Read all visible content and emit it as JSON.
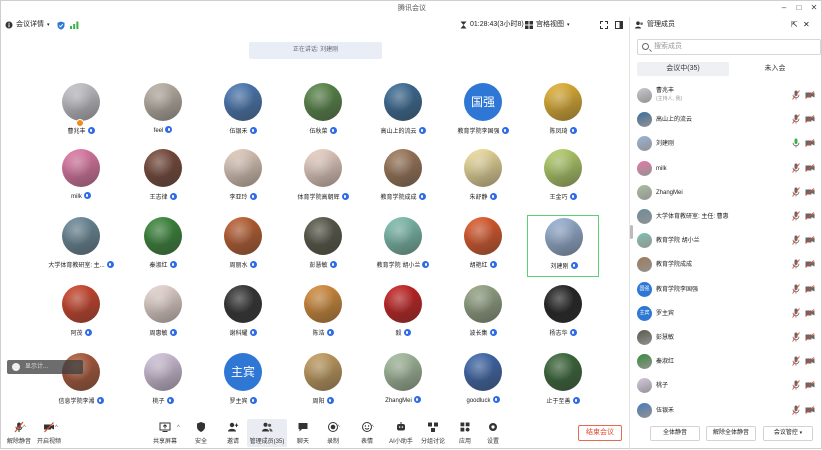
{
  "window": {
    "title": "腾讯会议"
  },
  "topbar": {
    "meeting_info_label": "会议详情",
    "timer": "01:28:43(3小时8)",
    "view_mode": "宫格视图"
  },
  "speaking": {
    "text": "正在讲话: 刘建刚"
  },
  "grid": {
    "tiles": [
      {
        "name": "曹兆丰",
        "avatar": "photo",
        "color": "#c9c9cf",
        "host": true
      },
      {
        "name": "feel",
        "avatar": "photo",
        "color": "#bfb6aa"
      },
      {
        "name": "伍银禾",
        "avatar": "photo",
        "color": "#4a7bb8"
      },
      {
        "name": "伍秋菜",
        "avatar": "photo",
        "color": "#5a8a4a"
      },
      {
        "name": "高山上的流云",
        "avatar": "photo",
        "color": "#3b6e9a"
      },
      {
        "name": "教育学院李国强",
        "avatar": "text",
        "text": "国强",
        "color": "#2f77d4"
      },
      {
        "name": "陈凤琦",
        "avatar": "photo",
        "color": "#e8b532"
      },
      {
        "name": "milk",
        "avatar": "photo",
        "color": "#e57aa8"
      },
      {
        "name": "王志律",
        "avatar": "photo",
        "color": "#7a4a3a"
      },
      {
        "name": "李亚玲",
        "avatar": "photo",
        "color": "#e6d0c0"
      },
      {
        "name": "体育学院高朝辉",
        "avatar": "photo",
        "color": "#f0d6c8"
      },
      {
        "name": "教育学院成成",
        "avatar": "photo",
        "color": "#a07a5a"
      },
      {
        "name": "朱舒静",
        "avatar": "photo",
        "color": "#f4e2a0"
      },
      {
        "name": "王金巧",
        "avatar": "photo",
        "color": "#b7d36a"
      },
      {
        "name": "大学体育教研室: 主...",
        "avatar": "photo",
        "color": "#6c8c9c"
      },
      {
        "name": "秦淑红",
        "avatar": "photo",
        "color": "#3a8a3a"
      },
      {
        "name": "周丽水",
        "avatar": "photo",
        "color": "#c06030"
      },
      {
        "name": "彭慧敏",
        "avatar": "photo",
        "color": "#5a5a4a"
      },
      {
        "name": "教育学院 胡小兰",
        "avatar": "photo",
        "color": "#7fc2b0"
      },
      {
        "name": "胡艳红",
        "avatar": "photo",
        "color": "#e45a2a"
      },
      {
        "name": "刘建刚",
        "avatar": "photo",
        "color": "#9ab4d8",
        "selected": true
      },
      {
        "name": "阿茂",
        "avatar": "photo",
        "color": "#d2442a"
      },
      {
        "name": "周惠敏",
        "avatar": "photo",
        "color": "#eedcd6"
      },
      {
        "name": "谢科耀",
        "avatar": "photo",
        "color": "#333333"
      },
      {
        "name": "陈浩",
        "avatar": "photo",
        "color": "#d98f3a"
      },
      {
        "name": "毅",
        "avatar": "photo",
        "color": "#cc2020"
      },
      {
        "name": "波长集",
        "avatar": "photo",
        "color": "#98a888"
      },
      {
        "name": "杨志华",
        "avatar": "photo",
        "color": "#222222"
      },
      {
        "name": "信息学院李湘",
        "avatar": "photo",
        "color": "#b05a3a"
      },
      {
        "name": "桃子",
        "avatar": "photo",
        "color": "#d7c8e0"
      },
      {
        "name": "罗主宾",
        "avatar": "text",
        "text": "主宾",
        "color": "#2f77d4"
      },
      {
        "name": "周阳",
        "avatar": "photo",
        "color": "#c8a060"
      },
      {
        "name": "ZhangMei",
        "avatar": "photo",
        "color": "#a8c0a0"
      },
      {
        "name": "goodluck",
        "avatar": "photo",
        "color": "#3e6ab0"
      },
      {
        "name": "止于至善",
        "avatar": "photo",
        "color": "#3a6a3a"
      }
    ]
  },
  "toast": {
    "text": "显示计..."
  },
  "toolbar": {
    "items": [
      {
        "label": "解除静音",
        "icon": "mic-off-icon"
      },
      {
        "label": "开启视频",
        "icon": "camera-off-icon"
      },
      {
        "label": "共享屏幕",
        "icon": "share-screen-icon"
      },
      {
        "label": "安全",
        "icon": "shield-icon"
      },
      {
        "label": "邀请",
        "icon": "invite-icon"
      },
      {
        "label": "管理成员(35)",
        "icon": "members-icon"
      },
      {
        "label": "聊天",
        "icon": "chat-icon"
      },
      {
        "label": "录制",
        "icon": "record-icon"
      },
      {
        "label": "表情",
        "icon": "emoji-icon"
      },
      {
        "label": "AI小助手",
        "icon": "ai-assistant-icon"
      },
      {
        "label": "分组讨论",
        "icon": "breakout-icon"
      },
      {
        "label": "应用",
        "icon": "apps-icon"
      },
      {
        "label": "设置",
        "icon": "settings-icon"
      }
    ],
    "end_label": "结束会议"
  },
  "panel": {
    "title": "管理成员",
    "search_placeholder": "搜索成员",
    "tab_in_meeting": "会议中(35)",
    "tab_not_joined": "未入会",
    "members": [
      {
        "name": "曹兆丰",
        "sub": "(主持人, 我)",
        "color": "#c9c9cf"
      },
      {
        "name": "高山上的流云",
        "color": "#3b6e9a"
      },
      {
        "name": "刘建刚",
        "color": "#9ab4d8"
      },
      {
        "name": "milk",
        "color": "#e57aa8"
      },
      {
        "name": "ZhangMei",
        "color": "#a8c0a0"
      },
      {
        "name": "大学体育教研室: 主任: 曹惠",
        "color": "#6c8c9c"
      },
      {
        "name": "教育学院 胡小兰",
        "color": "#7fc2b0"
      },
      {
        "name": "教育学院成成",
        "color": "#a07a5a"
      },
      {
        "name": "教育学院李国强",
        "color": "#2f77d4",
        "text": "国强"
      },
      {
        "name": "罗主宾",
        "color": "#2f77d4",
        "text": "主宾"
      },
      {
        "name": "彭慧敏",
        "color": "#5a5a4a"
      },
      {
        "name": "秦淑红",
        "color": "#3a8a3a"
      },
      {
        "name": "桃子",
        "color": "#d7c8e0"
      },
      {
        "name": "伍银禾",
        "color": "#4a7bb8"
      }
    ],
    "mute_all": "全体静音",
    "unmute_all": "解除全体静音",
    "meeting_control": "会议管控"
  }
}
